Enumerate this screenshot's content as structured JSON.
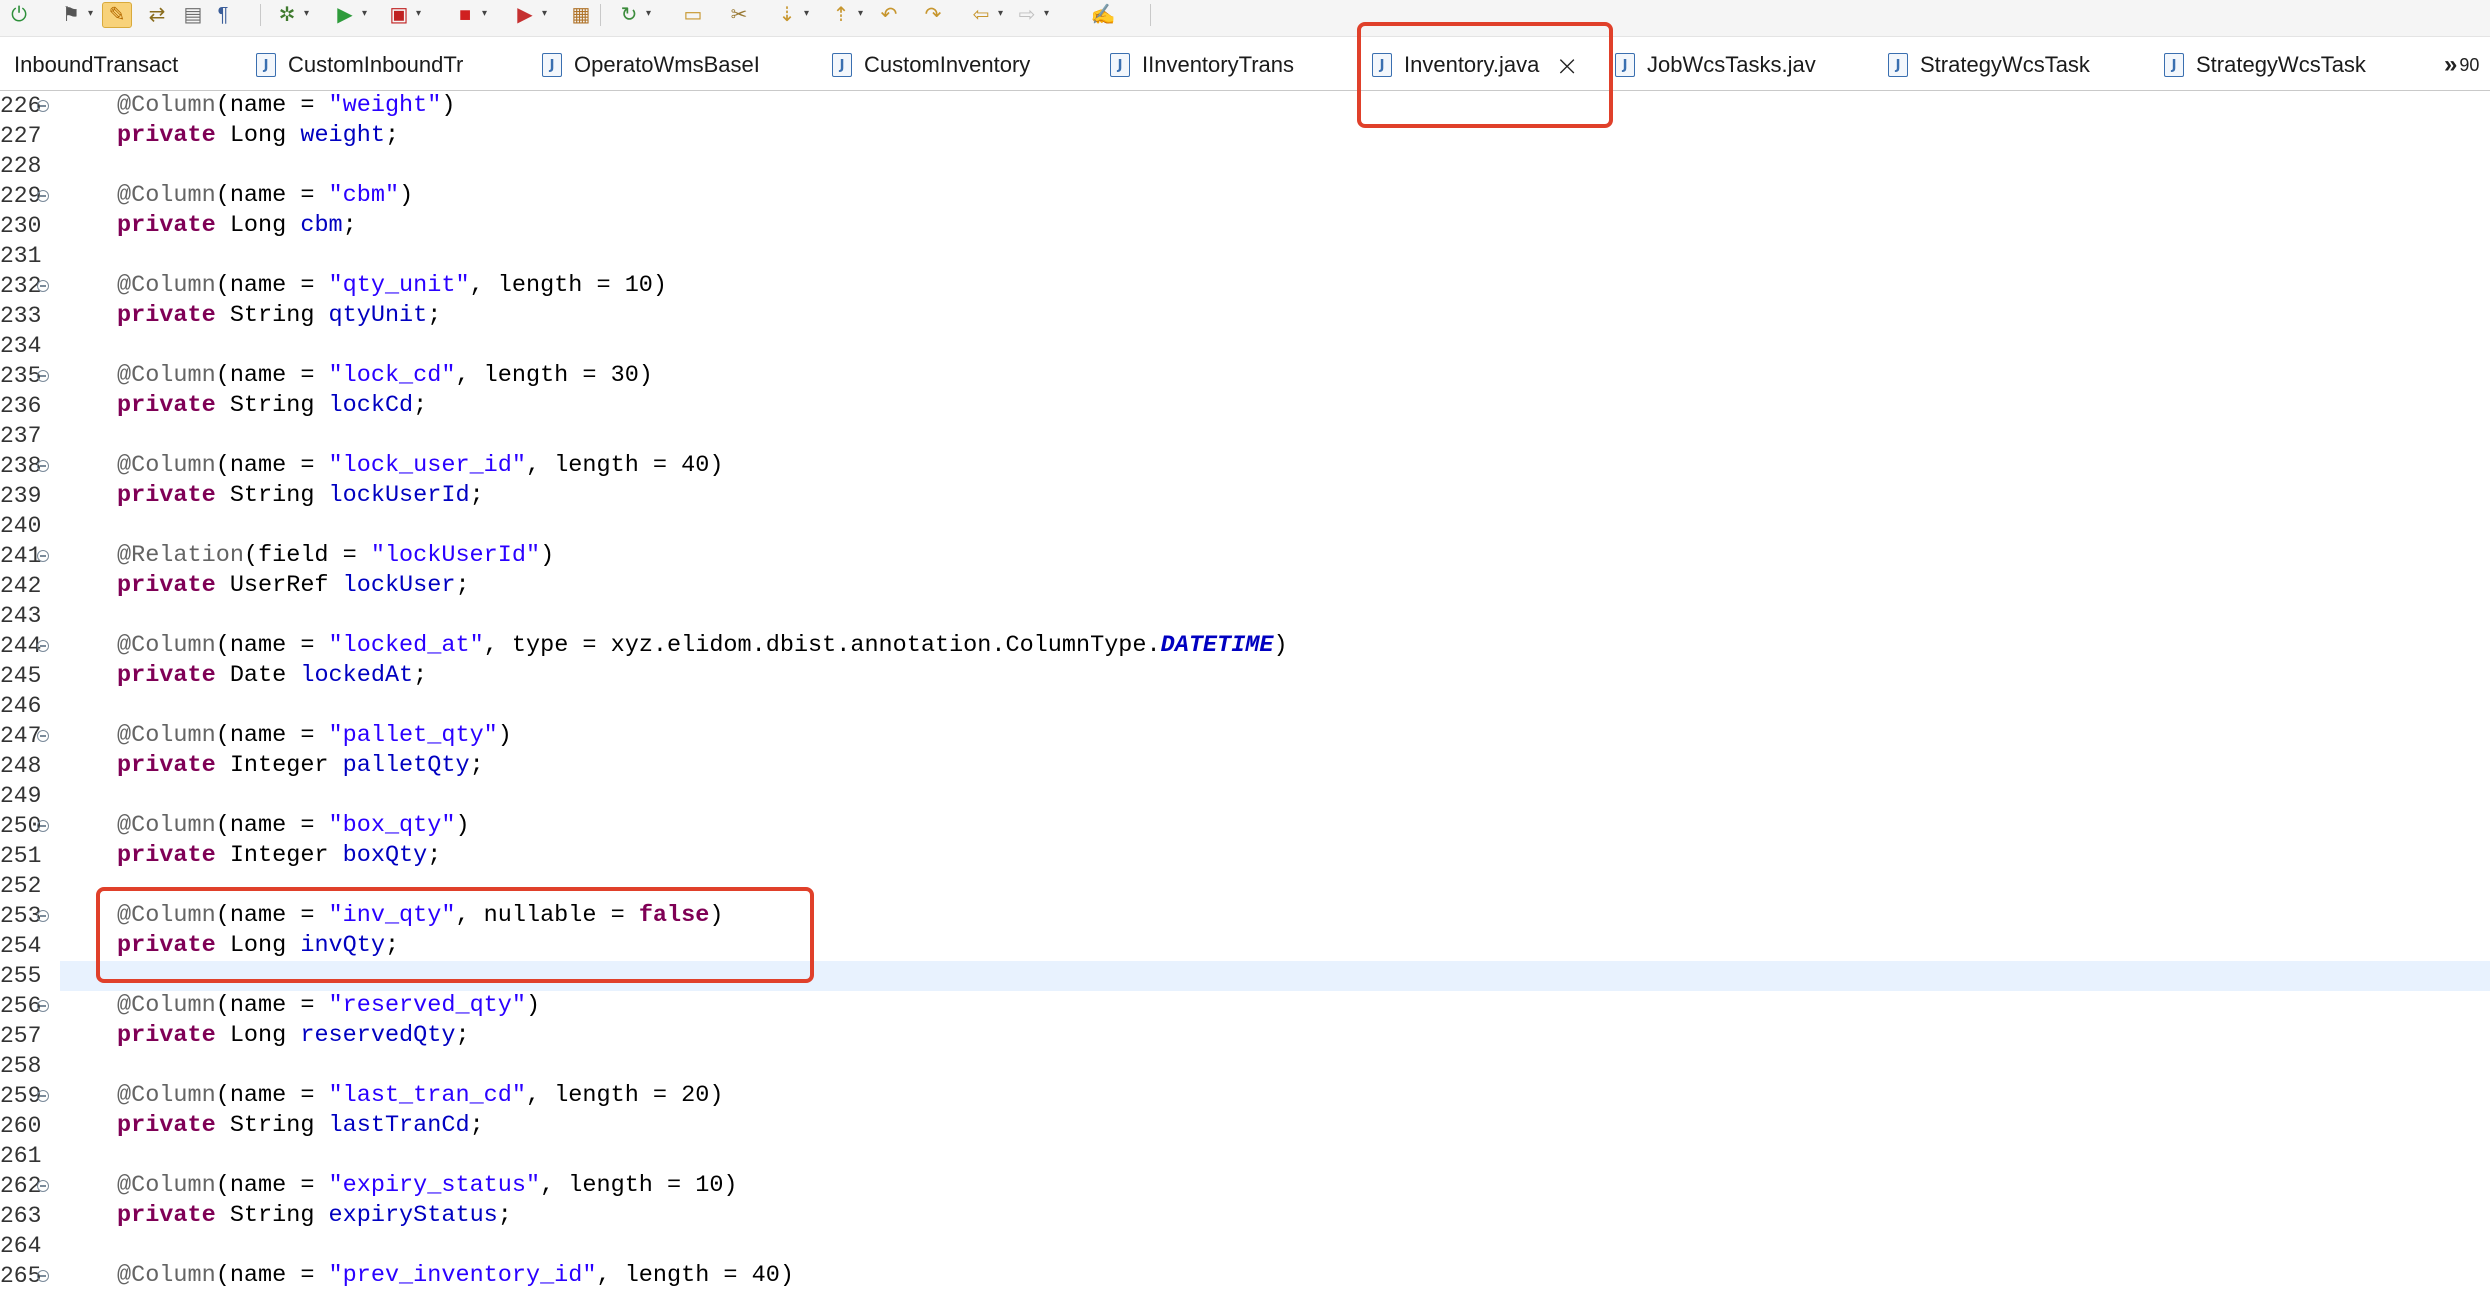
{
  "toolbar": {
    "icons": [
      {
        "name": "power-icon",
        "glyph": "⏻",
        "color": "#2d8f3a"
      },
      {
        "name": "debug-config-icon",
        "glyph": "⚑",
        "color": "#555555"
      },
      {
        "name": "edit-pencil-icon",
        "glyph": "✎",
        "color": "#b56b00"
      },
      {
        "name": "compare-icon",
        "glyph": "⇄",
        "color": "#8a6d1e"
      },
      {
        "name": "document-icon",
        "glyph": "▤",
        "color": "#6d6d6d"
      },
      {
        "name": "pilcrow-icon",
        "glyph": "¶",
        "color": "#3a5d99"
      },
      {
        "name": "bug-icon",
        "glyph": "✲",
        "color": "#3f7a2e"
      },
      {
        "name": "run-icon",
        "glyph": "▶",
        "color": "#2e9b3b"
      },
      {
        "name": "run-config-icon",
        "glyph": "▣",
        "color": "#c02020"
      },
      {
        "name": "stop-icon",
        "glyph": "■",
        "color": "#d02020"
      },
      {
        "name": "launch-icon",
        "glyph": "▶",
        "color": "#c53030"
      },
      {
        "name": "package-icon",
        "glyph": "▦",
        "color": "#b0742a"
      },
      {
        "name": "refresh-icon",
        "glyph": "↻",
        "color": "#3c8c3c"
      },
      {
        "name": "open-folder-icon",
        "glyph": "▭",
        "color": "#c7962e"
      },
      {
        "name": "wrench-icon",
        "glyph": "✂",
        "color": "#9a7a35"
      },
      {
        "name": "next-annotation-icon",
        "glyph": "⇣",
        "color": "#c7962e"
      },
      {
        "name": "previous-annotation-icon",
        "glyph": "⇡",
        "color": "#c7962e"
      },
      {
        "name": "last-edit-icon",
        "glyph": "↶",
        "color": "#c7962e"
      },
      {
        "name": "forward-edit-icon",
        "glyph": "↷",
        "color": "#c7962e"
      },
      {
        "name": "back-icon",
        "glyph": "⇦",
        "color": "#c7962e"
      },
      {
        "name": "forward-icon",
        "glyph": "⇨",
        "color": "#c0c0c0"
      },
      {
        "name": "task-icon",
        "glyph": "✍",
        "color": "#3a5d99"
      }
    ]
  },
  "tabs": [
    {
      "label": "InboundTransact",
      "icon": false
    },
    {
      "label": "CustomInboundTr",
      "icon": true
    },
    {
      "label": "OperatoWmsBaseI",
      "icon": true
    },
    {
      "label": "CustomInventory",
      "icon": true
    },
    {
      "label": "IInventoryTrans",
      "icon": true
    },
    {
      "label": "Inventory.java",
      "icon": true,
      "active": true
    },
    {
      "label": "JobWcsTasks.jav",
      "icon": true
    },
    {
      "label": "StrategyWcsTask",
      "icon": true
    },
    {
      "label": "StrategyWcsTask",
      "icon": true
    }
  ],
  "tab_icon_letter": "J",
  "tab_close_glyph": "×",
  "tab_overflow": {
    "chevron": "»",
    "count": "90"
  },
  "editor": {
    "current_line": "255",
    "lines": [
      {
        "n": "226",
        "fold": true,
        "tokens": [
          {
            "t": "ann",
            "v": "@Column"
          },
          {
            "t": "p",
            "v": "(name = "
          },
          {
            "t": "str",
            "v": "\"weight\""
          },
          {
            "t": "p",
            "v": ")"
          }
        ]
      },
      {
        "n": "227",
        "tokens": [
          {
            "t": "kw",
            "v": "private"
          },
          {
            "t": "p",
            "v": " Long "
          },
          {
            "t": "fld",
            "v": "weight"
          },
          {
            "t": "p",
            "v": ";"
          }
        ]
      },
      {
        "n": "228",
        "tokens": []
      },
      {
        "n": "229",
        "fold": true,
        "tokens": [
          {
            "t": "ann",
            "v": "@Column"
          },
          {
            "t": "p",
            "v": "(name = "
          },
          {
            "t": "str",
            "v": "\"cbm\""
          },
          {
            "t": "p",
            "v": ")"
          }
        ]
      },
      {
        "n": "230",
        "tokens": [
          {
            "t": "kw",
            "v": "private"
          },
          {
            "t": "p",
            "v": " Long "
          },
          {
            "t": "fld",
            "v": "cbm"
          },
          {
            "t": "p",
            "v": ";"
          }
        ]
      },
      {
        "n": "231",
        "tokens": []
      },
      {
        "n": "232",
        "fold": true,
        "tokens": [
          {
            "t": "ann",
            "v": "@Column"
          },
          {
            "t": "p",
            "v": "(name = "
          },
          {
            "t": "str",
            "v": "\"qty_unit\""
          },
          {
            "t": "p",
            "v": ", length = 10)"
          }
        ]
      },
      {
        "n": "233",
        "tokens": [
          {
            "t": "kw",
            "v": "private"
          },
          {
            "t": "p",
            "v": " String "
          },
          {
            "t": "fld",
            "v": "qtyUnit"
          },
          {
            "t": "p",
            "v": ";"
          }
        ]
      },
      {
        "n": "234",
        "tokens": []
      },
      {
        "n": "235",
        "fold": true,
        "tokens": [
          {
            "t": "ann",
            "v": "@Column"
          },
          {
            "t": "p",
            "v": "(name = "
          },
          {
            "t": "str",
            "v": "\"lock_cd\""
          },
          {
            "t": "p",
            "v": ", length = 30)"
          }
        ]
      },
      {
        "n": "236",
        "tokens": [
          {
            "t": "kw",
            "v": "private"
          },
          {
            "t": "p",
            "v": " String "
          },
          {
            "t": "fld",
            "v": "lockCd"
          },
          {
            "t": "p",
            "v": ";"
          }
        ]
      },
      {
        "n": "237",
        "tokens": []
      },
      {
        "n": "238",
        "fold": true,
        "tokens": [
          {
            "t": "ann",
            "v": "@Column"
          },
          {
            "t": "p",
            "v": "(name = "
          },
          {
            "t": "str",
            "v": "\"lock_user_id\""
          },
          {
            "t": "p",
            "v": ", length = 40)"
          }
        ]
      },
      {
        "n": "239",
        "tokens": [
          {
            "t": "kw",
            "v": "private"
          },
          {
            "t": "p",
            "v": " String "
          },
          {
            "t": "fld",
            "v": "lockUserId"
          },
          {
            "t": "p",
            "v": ";"
          }
        ]
      },
      {
        "n": "240",
        "tokens": []
      },
      {
        "n": "241",
        "fold": true,
        "tokens": [
          {
            "t": "ann",
            "v": "@Relation"
          },
          {
            "t": "p",
            "v": "(field = "
          },
          {
            "t": "str",
            "v": "\"lockUserId\""
          },
          {
            "t": "p",
            "v": ")"
          }
        ]
      },
      {
        "n": "242",
        "tokens": [
          {
            "t": "kw",
            "v": "private"
          },
          {
            "t": "p",
            "v": " UserRef "
          },
          {
            "t": "fld",
            "v": "lockUser"
          },
          {
            "t": "p",
            "v": ";"
          }
        ]
      },
      {
        "n": "243",
        "tokens": []
      },
      {
        "n": "244",
        "fold": true,
        "tokens": [
          {
            "t": "ann",
            "v": "@Column"
          },
          {
            "t": "p",
            "v": "(name = "
          },
          {
            "t": "str",
            "v": "\"locked_at\""
          },
          {
            "t": "p",
            "v": ", type = xyz.elidom.dbist.annotation.ColumnType."
          },
          {
            "t": "cst",
            "v": "DATETIME"
          },
          {
            "t": "p",
            "v": ")"
          }
        ]
      },
      {
        "n": "245",
        "tokens": [
          {
            "t": "kw",
            "v": "private"
          },
          {
            "t": "p",
            "v": " Date "
          },
          {
            "t": "fld",
            "v": "lockedAt"
          },
          {
            "t": "p",
            "v": ";"
          }
        ]
      },
      {
        "n": "246",
        "tokens": []
      },
      {
        "n": "247",
        "fold": true,
        "tokens": [
          {
            "t": "ann",
            "v": "@Column"
          },
          {
            "t": "p",
            "v": "(name = "
          },
          {
            "t": "str",
            "v": "\"pallet_qty\""
          },
          {
            "t": "p",
            "v": ")"
          }
        ]
      },
      {
        "n": "248",
        "tokens": [
          {
            "t": "kw",
            "v": "private"
          },
          {
            "t": "p",
            "v": " Integer "
          },
          {
            "t": "fld",
            "v": "palletQty"
          },
          {
            "t": "p",
            "v": ";"
          }
        ]
      },
      {
        "n": "249",
        "tokens": []
      },
      {
        "n": "250",
        "fold": true,
        "tokens": [
          {
            "t": "ann",
            "v": "@Column"
          },
          {
            "t": "p",
            "v": "(name = "
          },
          {
            "t": "str",
            "v": "\"box_qty\""
          },
          {
            "t": "p",
            "v": ")"
          }
        ]
      },
      {
        "n": "251",
        "tokens": [
          {
            "t": "kw",
            "v": "private"
          },
          {
            "t": "p",
            "v": " Integer "
          },
          {
            "t": "fld",
            "v": "boxQty"
          },
          {
            "t": "p",
            "v": ";"
          }
        ]
      },
      {
        "n": "252",
        "tokens": []
      },
      {
        "n": "253",
        "fold": true,
        "tokens": [
          {
            "t": "ann",
            "v": "@Column"
          },
          {
            "t": "p",
            "v": "(name = "
          },
          {
            "t": "str",
            "v": "\"inv_qty\""
          },
          {
            "t": "p",
            "v": ", nullable = "
          },
          {
            "t": "kw",
            "v": "false"
          },
          {
            "t": "p",
            "v": ")"
          }
        ]
      },
      {
        "n": "254",
        "tokens": [
          {
            "t": "kw",
            "v": "private"
          },
          {
            "t": "p",
            "v": " Long "
          },
          {
            "t": "fld",
            "v": "invQty"
          },
          {
            "t": "p",
            "v": ";"
          }
        ]
      },
      {
        "n": "255",
        "tokens": []
      },
      {
        "n": "256",
        "fold": true,
        "tokens": [
          {
            "t": "ann",
            "v": "@Column"
          },
          {
            "t": "p",
            "v": "(name = "
          },
          {
            "t": "str",
            "v": "\"reserved_qty\""
          },
          {
            "t": "p",
            "v": ")"
          }
        ]
      },
      {
        "n": "257",
        "tokens": [
          {
            "t": "kw",
            "v": "private"
          },
          {
            "t": "p",
            "v": " Long "
          },
          {
            "t": "fld",
            "v": "reservedQty"
          },
          {
            "t": "p",
            "v": ";"
          }
        ]
      },
      {
        "n": "258",
        "tokens": []
      },
      {
        "n": "259",
        "fold": true,
        "tokens": [
          {
            "t": "ann",
            "v": "@Column"
          },
          {
            "t": "p",
            "v": "(name = "
          },
          {
            "t": "str",
            "v": "\"last_tran_cd\""
          },
          {
            "t": "p",
            "v": ", length = 20)"
          }
        ]
      },
      {
        "n": "260",
        "tokens": [
          {
            "t": "kw",
            "v": "private"
          },
          {
            "t": "p",
            "v": " String "
          },
          {
            "t": "fld",
            "v": "lastTranCd"
          },
          {
            "t": "p",
            "v": ";"
          }
        ]
      },
      {
        "n": "261",
        "tokens": []
      },
      {
        "n": "262",
        "fold": true,
        "tokens": [
          {
            "t": "ann",
            "v": "@Column"
          },
          {
            "t": "p",
            "v": "(name = "
          },
          {
            "t": "str",
            "v": "\"expiry_status\""
          },
          {
            "t": "p",
            "v": ", length = 10)"
          }
        ]
      },
      {
        "n": "263",
        "tokens": [
          {
            "t": "kw",
            "v": "private"
          },
          {
            "t": "p",
            "v": " String "
          },
          {
            "t": "fld",
            "v": "expiryStatus"
          },
          {
            "t": "p",
            "v": ";"
          }
        ]
      },
      {
        "n": "264",
        "tokens": []
      },
      {
        "n": "265",
        "fold": true,
        "tokens": [
          {
            "t": "ann",
            "v": "@Column"
          },
          {
            "t": "p",
            "v": "(name = "
          },
          {
            "t": "str",
            "v": "\"prev_inventory_id\""
          },
          {
            "t": "p",
            "v": ", length = 40)"
          }
        ]
      }
    ]
  },
  "colors": {
    "keyword": "#7f0055",
    "string": "#2a00ff",
    "field": "#0000c0",
    "annotation": "#646464",
    "current_line_bg": "#e8f2fe",
    "highlight_box": "#e0402a"
  }
}
